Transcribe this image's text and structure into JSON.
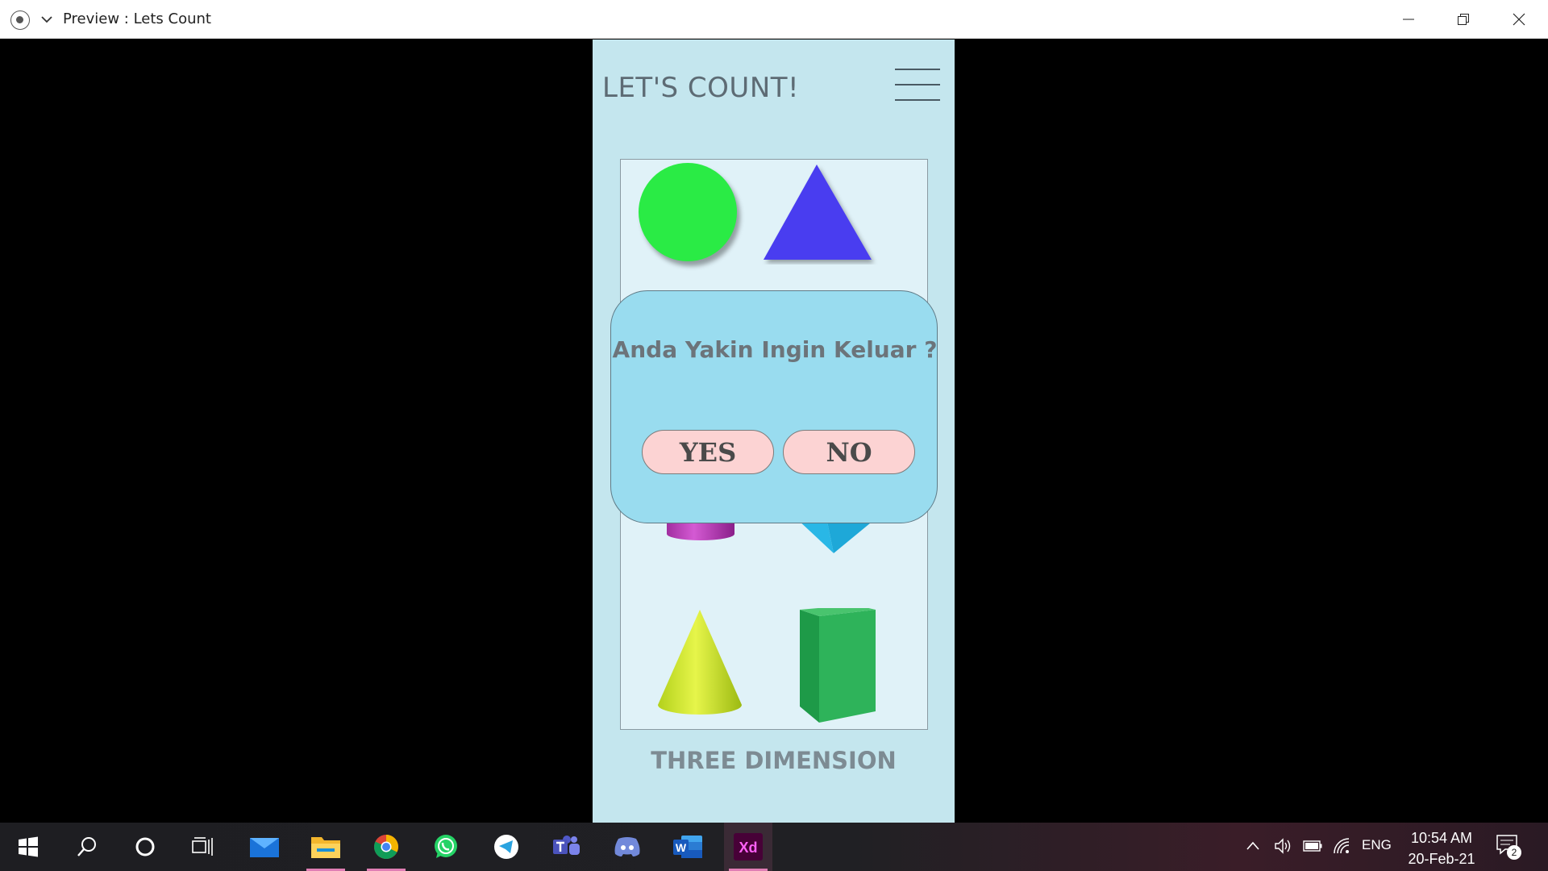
{
  "window": {
    "title": "Preview : Lets Count"
  },
  "app": {
    "title": "LET'S COUNT!",
    "footer_label": "THREE DIMENSION"
  },
  "dialog": {
    "question": "Anda Yakin Ingin Keluar ?",
    "yes_label": "YES",
    "no_label": "NO"
  },
  "taskbar": {
    "language": "ENG",
    "time": "10:54 AM",
    "date": "20-Feb-21",
    "notification_count": "2",
    "apps": [
      "start-icon",
      "search-icon",
      "cortana-icon",
      "task-view-icon",
      "mail-icon",
      "file-explorer-icon",
      "chrome-icon",
      "whatsapp-icon",
      "telegram-icon",
      "teams-icon",
      "discord-icon",
      "word-icon",
      "adobe-xd-icon"
    ],
    "xd_label": "Xd",
    "word_label": "W"
  },
  "colors": {
    "artboard_bg": "#c4e6ee",
    "dialog_bg": "#99dcef",
    "button_bg": "#fcd3d3",
    "circle": "#2aeb45",
    "triangle": "#4a3cf0"
  }
}
